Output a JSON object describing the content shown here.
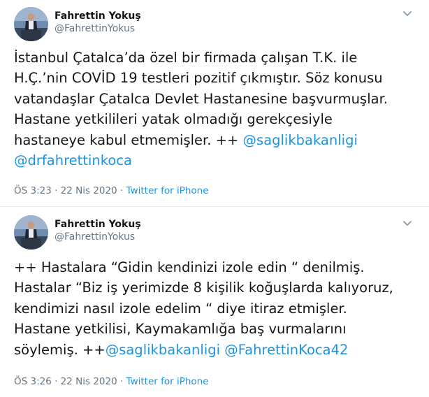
{
  "tweets": [
    {
      "author": {
        "name": "Fahrettin Yokuş",
        "handle": "@FahrettinYokus"
      },
      "text_lines": [
        [
          {
            "t": "İstanbul Çatalca’da özel bir firmada çalışan T.K. ile"
          }
        ],
        [
          {
            "t": "H.Ç.’nin COVİD 19 testleri pozitif çıkmıştır. Söz konusu"
          }
        ],
        [
          {
            "t": "vatandaşlar Çatalca Devlet Hastanesine başvurmuşlar."
          }
        ],
        [
          {
            "t": "Hastane yetkilileri yatak olmadığı gerekçesiyle"
          }
        ],
        [
          {
            "t": "hastaneye kabul etmemişler. ++ "
          },
          {
            "t": "@saglikbakanligi",
            "mention": true
          }
        ],
        [
          {
            "t": "@drfahrettinkoca",
            "mention": true
          }
        ]
      ],
      "time": "ÖS 3:23 · 22 Nis 2020",
      "separator": " · ",
      "source": "Twitter for iPhone"
    },
    {
      "author": {
        "name": "Fahrettin Yokuş",
        "handle": "@FahrettinYokus"
      },
      "text_lines": [
        [
          {
            "t": "++ Hastalara “Gidin kendinizi izole edin “ denilmiş."
          }
        ],
        [
          {
            "t": "Hastalar “Biz iş yerimizde 8 kişilik koğuşlarda kalıyoruz,"
          }
        ],
        [
          {
            "t": "kendimizi nasıl izole edelim “ diye itiraz etmişler."
          }
        ],
        [
          {
            "t": "Hastane yetkilisi, Kaymakamlığa baş vurmalarını"
          }
        ],
        [
          {
            "t": "söylemiş. ++"
          },
          {
            "t": "@saglikbakanligi",
            "mention": true
          },
          {
            "t": " "
          },
          {
            "t": "@FahrettinKoca42",
            "mention": true
          }
        ]
      ],
      "time": "ÖS 3:26 · 22 Nis 2020",
      "separator": " · ",
      "source": "Twitter for iPhone"
    }
  ],
  "colors": {
    "text": "#14171a",
    "secondary": "#657786",
    "link": "#1b95e0",
    "divider": "#e6ecf0"
  },
  "icons": {
    "avatar": "avatar-photo",
    "caret": "chevron-down-icon"
  }
}
